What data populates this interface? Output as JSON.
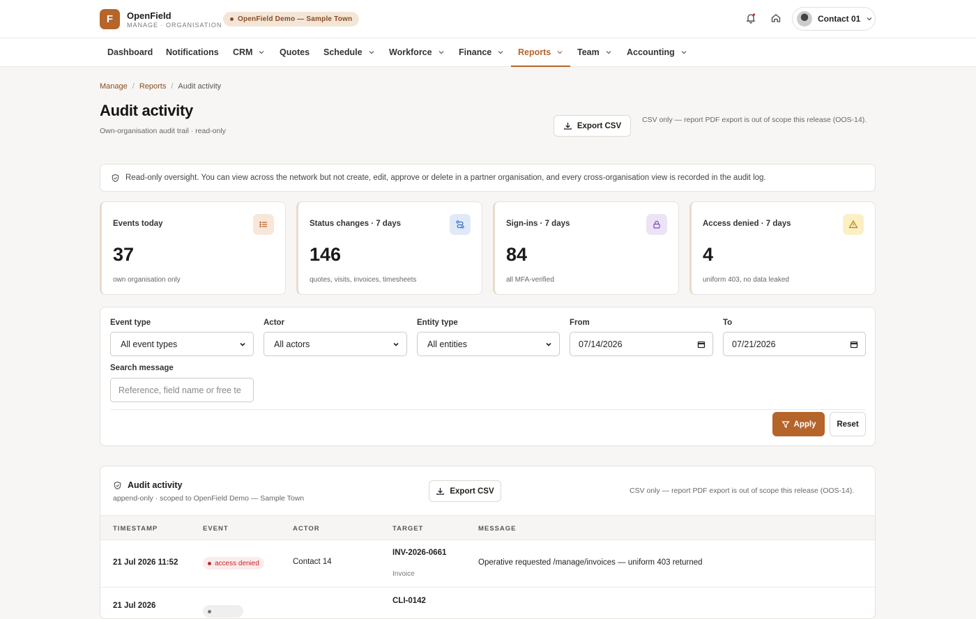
{
  "brand": {
    "logo_letter": "F",
    "name": "OpenField",
    "sub": "MANAGE · ORGANISATION"
  },
  "tenant": {
    "label": "OpenField Demo — Sample Town"
  },
  "user": {
    "name": "Contact 01"
  },
  "nav": {
    "items": [
      {
        "label": "Dashboard"
      },
      {
        "label": "Notifications"
      },
      {
        "label": "CRM"
      },
      {
        "label": "Quotes"
      },
      {
        "label": "Schedule"
      },
      {
        "label": "Workforce"
      },
      {
        "label": "Finance"
      },
      {
        "label": "Reports"
      },
      {
        "label": "Team"
      },
      {
        "label": "Accounting"
      }
    ],
    "active": "Reports"
  },
  "breadcrumb": {
    "root": "Manage",
    "section": "Reports",
    "current": "Audit activity",
    "sep": "/"
  },
  "page": {
    "title": "Audit activity",
    "subtitle": "Own-organisation audit trail · read-only",
    "export_label": "Export CSV",
    "export_note": "CSV only — report PDF export is out of scope this release (OOS-14)."
  },
  "banner": {
    "text": "Read-only oversight. You can view across the network but not create, edit, approve or delete in a partner organisation, and every cross-organisation view is recorded in the audit log."
  },
  "stats": [
    {
      "label": "Events today",
      "value": "37",
      "foot": "own organisation only",
      "icon": "list-icon",
      "color": "#f7e7da"
    },
    {
      "label": "Status changes · 7 days",
      "value": "146",
      "foot": "quotes, visits, invoices, timesheets",
      "icon": "route-icon",
      "color": "#dfe9f8"
    },
    {
      "label": "Sign-ins · 7 days",
      "value": "84",
      "foot": "all MFA-verified",
      "icon": "lock-icon",
      "color": "#ece3f6"
    },
    {
      "label": "Access denied · 7 days",
      "value": "4",
      "foot": "uniform 403, no data leaked",
      "icon": "warning-icon",
      "color": "#fbefc4"
    }
  ],
  "filters": {
    "event_type": {
      "label": "Event type",
      "value": "All event types"
    },
    "actor": {
      "label": "Actor",
      "value": "All actors"
    },
    "entity_type": {
      "label": "Entity type",
      "value": "All entities"
    },
    "from": {
      "label": "From",
      "value": "07/14/2026"
    },
    "to": {
      "label": "To",
      "value": "07/21/2026"
    },
    "search": {
      "label": "Search message",
      "placeholder": "Reference, field name or free te"
    },
    "apply_label": "Apply",
    "reset_label": "Reset"
  },
  "table": {
    "title": "Audit activity",
    "subtitle": "append-only · scoped to OpenField Demo — Sample Town",
    "export_label": "Export CSV",
    "export_note": "CSV only — report PDF export is out of scope this release (OOS-14).",
    "columns": [
      "TIMESTAMP",
      "EVENT",
      "ACTOR",
      "TARGET",
      "MESSAGE"
    ],
    "rows": [
      {
        "timestamp": "21 Jul 2026 11:52",
        "event": "access denied",
        "actor": "Contact 14",
        "target": "INV-2026-0661",
        "target_type": "Invoice",
        "message": "Operative requested /manage/invoices — uniform 403 returned"
      },
      {
        "timestamp": "21 Jul 2026",
        "event": "",
        "actor": "",
        "target": "CLI-0142",
        "target_type": "",
        "message": ""
      }
    ]
  }
}
